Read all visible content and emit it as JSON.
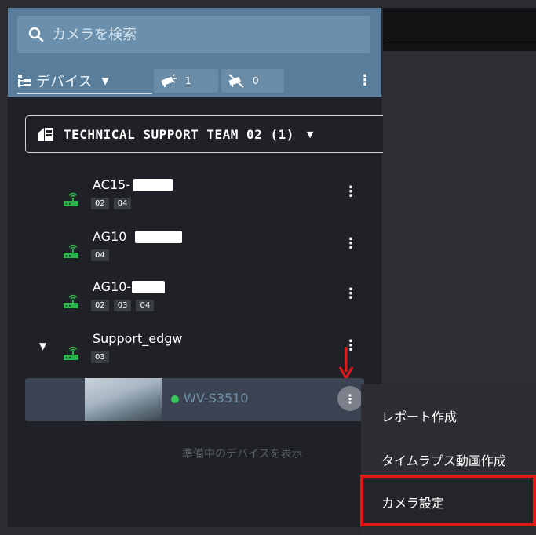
{
  "search": {
    "placeholder": "カメラを検索"
  },
  "toolbar": {
    "device_label": "デバイス",
    "online_count": "1",
    "offline_count": "0"
  },
  "team": {
    "name": "TECHNICAL SUPPORT TEAM 02 (1)"
  },
  "devices": [
    {
      "name": "AC15-",
      "tags": [
        "02",
        "04"
      ]
    },
    {
      "name": "AG10",
      "tags": [
        "04"
      ]
    },
    {
      "name": "AG10-",
      "tags": [
        "02",
        "03",
        "04"
      ]
    },
    {
      "name": "Support_edgw",
      "tags": [
        "03"
      ]
    }
  ],
  "camera": {
    "name": "WV-S3510",
    "status_color": "#34c759"
  },
  "show_preparing_label": "準備中のデバイスを表示",
  "context_menu": {
    "items": [
      {
        "label": "レポート作成"
      },
      {
        "label": "タイムラプス動画作成"
      },
      {
        "label": "カメラ設定"
      }
    ]
  },
  "colors": {
    "highlight": "#e0191b",
    "accent": "#587e9c"
  }
}
